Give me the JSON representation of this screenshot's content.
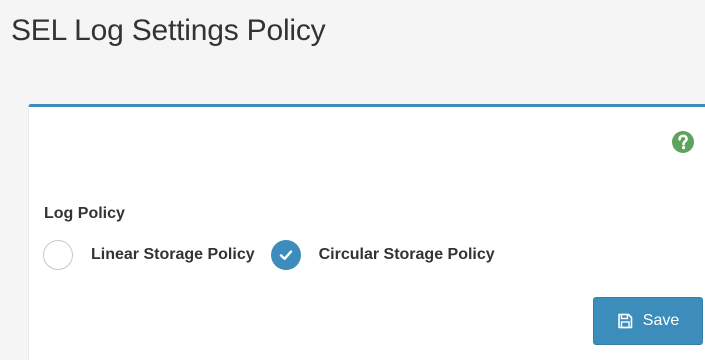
{
  "page": {
    "title": "SEL Log Settings Policy"
  },
  "form": {
    "help_icon": "question-circle-icon",
    "log_policy": {
      "label": "Log Policy",
      "options": [
        {
          "label": "Linear Storage Policy",
          "selected": false
        },
        {
          "label": "Circular Storage Policy",
          "selected": true
        }
      ]
    },
    "save_button": {
      "label": "Save",
      "icon": "floppy-disk-icon"
    }
  },
  "colors": {
    "accent": "#3c8dbc",
    "help_icon": "#5ca35c",
    "page_background": "#f5f5f5",
    "panel_background": "#ffffff"
  }
}
